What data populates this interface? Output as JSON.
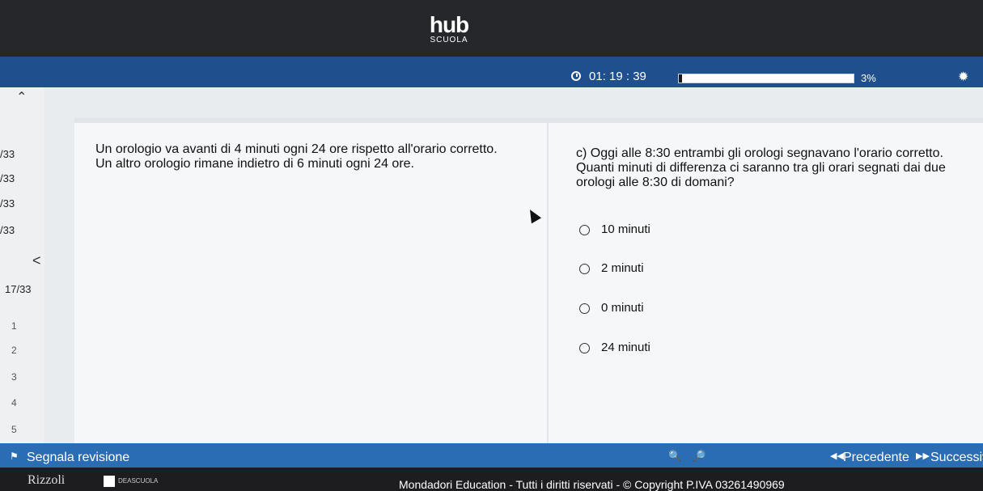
{
  "header": {
    "logo_main": "hub",
    "logo_sub": "SCUOLA"
  },
  "timer": {
    "icon": "clock-icon",
    "value": "01: 19 : 39",
    "progress_fraction": 0.02,
    "percent_label": "3%",
    "settings_icon": "gear-icon"
  },
  "sidebar": {
    "items": [
      "/33",
      "/33",
      "/33",
      "/33",
      "17/33"
    ],
    "numbers": [
      "1",
      "2",
      "3",
      "4",
      "5"
    ]
  },
  "question": {
    "text_line1": "Un orologio va avanti di 4 minuti ogni 24 ore rispetto all'orario corretto.",
    "text_line2": "Un altro orologio rimane indietro di 6 minuti ogni 24 ore.",
    "prompt": "c) Oggi alle 8:30 entrambi gli orologi segnavano l'orario corretto. Quanti minuti di differenza ci saranno tra gli orari segnati dai due orologi alle 8:30 di domani?",
    "options": [
      "10 minuti",
      "2 minuti",
      "0 minuti",
      "24 minuti"
    ]
  },
  "bottom_bar": {
    "flag_label": "Segnala revisione",
    "prev_label": "Precedente",
    "next_label": "Successiv"
  },
  "footer": {
    "brand": "Rizzoli",
    "brand2": "DEASCUOLA",
    "copyright": "Mondadori Education - Tutti i diritti riservati - © Copyright P.IVA  03261490969"
  },
  "colors": {
    "topbar": "#26272b",
    "timerbar": "#1f4f8c",
    "bottombar": "#2a6db5"
  }
}
